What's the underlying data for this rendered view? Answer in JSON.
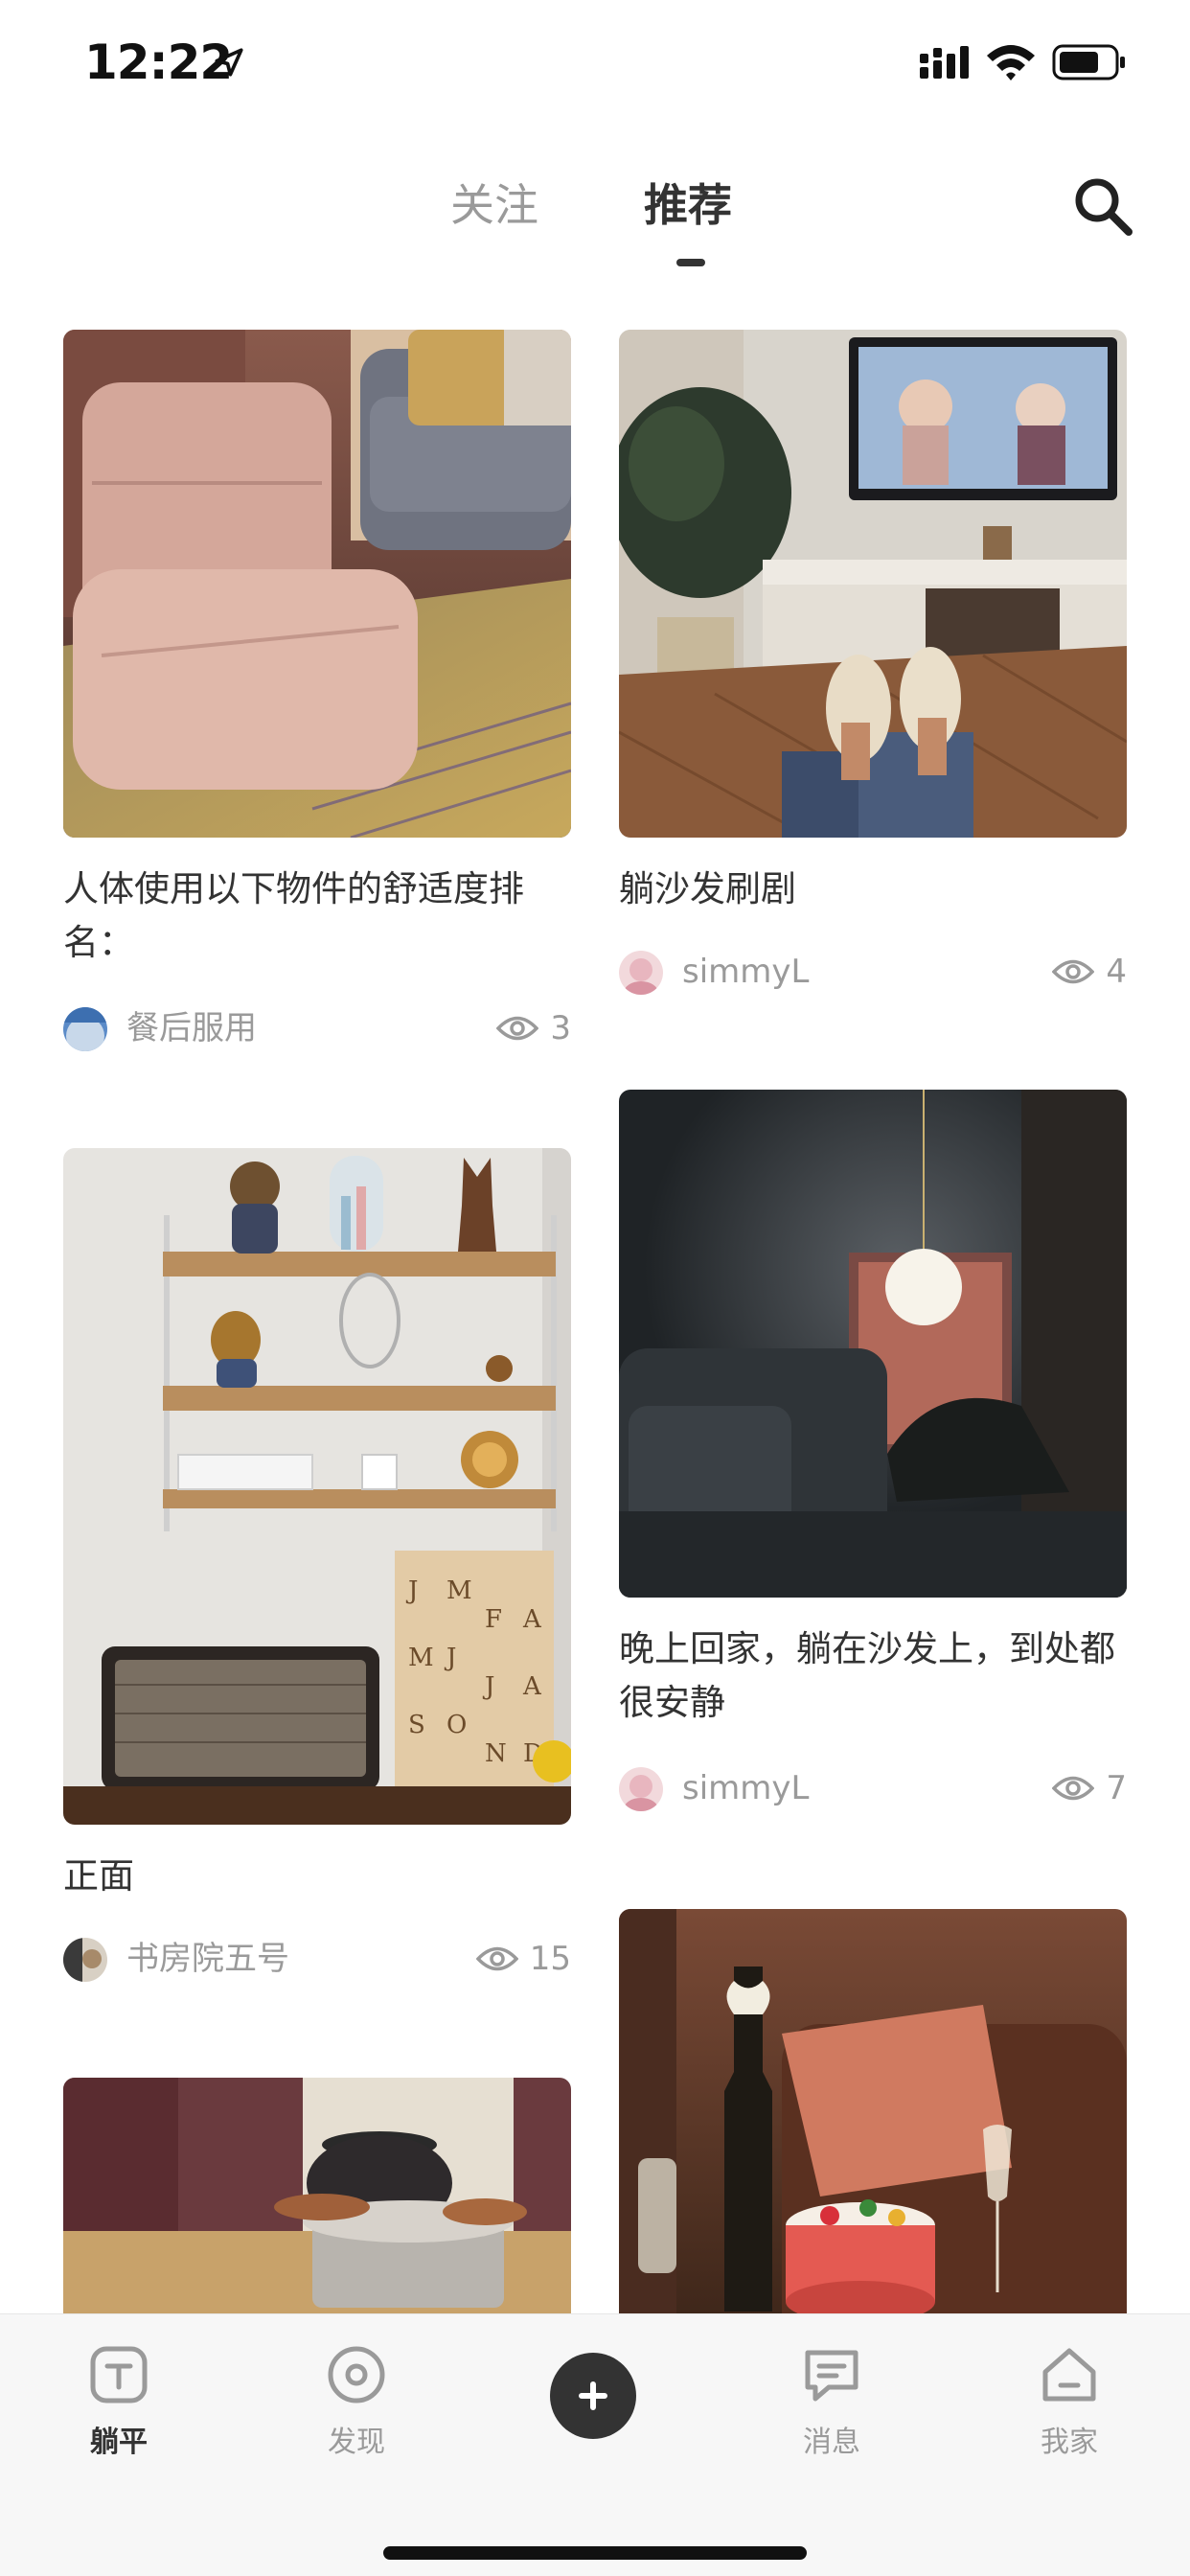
{
  "status_bar": {
    "time": "12:22"
  },
  "top_tabs": {
    "follow": "关注",
    "recommend": "推荐",
    "active": "recommend"
  },
  "feed": {
    "cards": [
      {
        "title": "人体使用以下物件的舒适度排名：",
        "author": "餐后服用",
        "views": "3",
        "image": "floor-chair-sofa-photo"
      },
      {
        "title": "躺沙发刷剧",
        "author": "simmyL",
        "views": "4",
        "image": "feet-slippers-tv-photo"
      },
      {
        "title": "正面",
        "author": "书房院五号",
        "views": "15",
        "image": "wall-shelf-marshall-speaker-photo"
      },
      {
        "title": "晚上回家，躺在沙发上，到处都很安静",
        "author": "simmyL",
        "views": "7",
        "image": "dark-room-pendant-lamp-photo"
      },
      {
        "image": "teapot-on-grill-photo"
      },
      {
        "image": "champagne-cake-gift-photo"
      }
    ]
  },
  "tabbar": {
    "items": [
      {
        "label": "躺平",
        "icon": "tangping-icon",
        "active": true
      },
      {
        "label": "发现",
        "icon": "discover-icon",
        "active": false
      },
      {
        "label": "消息",
        "icon": "message-icon",
        "active": false
      },
      {
        "label": "我家",
        "icon": "home-icon",
        "active": false
      }
    ],
    "publish_icon": "plus-icon"
  },
  "colors": {
    "text_primary": "#333333",
    "text_secondary": "#9a9a9a",
    "tabbar_bg": "#f7f7f7",
    "publish_button": "#333333"
  }
}
